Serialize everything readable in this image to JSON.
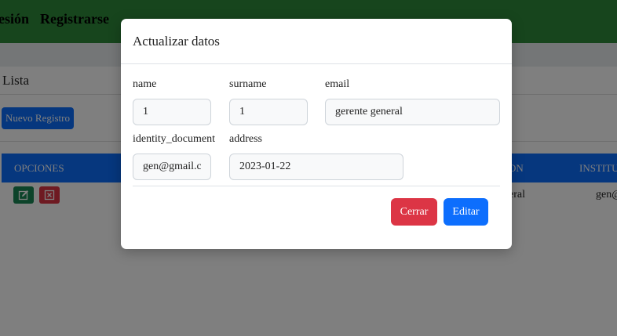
{
  "navbar": {
    "links": [
      "esión",
      "Registrarse"
    ]
  },
  "card": {
    "title": "Lista",
    "new_button": "Nuevo Registro"
  },
  "table": {
    "headers": [
      "OPCIONES",
      "ON",
      "INSTITUT"
    ],
    "row": [
      "eral",
      "gen@"
    ]
  },
  "colors": {
    "navbar": "#2e8b3a",
    "primary": "#0d6efd",
    "danger": "#dc3545",
    "success": "#198754"
  },
  "modal": {
    "title": "Actualizar datos",
    "fields": {
      "name": {
        "label": "name",
        "value": "1"
      },
      "surname": {
        "label": "surname",
        "value": "1"
      },
      "email": {
        "label": "email",
        "value": "gerente general"
      },
      "identity_document": {
        "label": "identity_document",
        "value": "gen@gmail.com"
      },
      "address": {
        "label": "address",
        "value": "2023-01-22"
      }
    },
    "close_button": "Cerrar",
    "edit_button": "Editar"
  }
}
